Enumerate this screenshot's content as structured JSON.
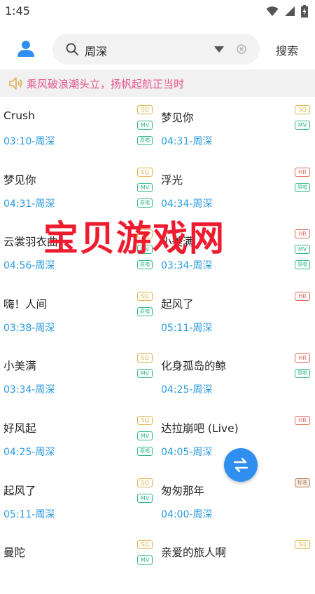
{
  "status_bar": {
    "time": "1:45"
  },
  "header": {
    "search_value": "周深",
    "search_button": "搜索"
  },
  "notice": {
    "text": "乘风破浪潮头立，扬帆起航正当时"
  },
  "songs": [
    {
      "title": "Crush",
      "meta": "03:10-周深",
      "badges": [
        {
          "type": "sq",
          "label": "SQ"
        },
        {
          "type": "mv",
          "label": "MV"
        },
        {
          "type": "src",
          "label": "原唱"
        }
      ]
    },
    {
      "title": "梦见你",
      "meta": "04:31-周深",
      "badges": [
        {
          "type": "sq",
          "label": "SQ"
        },
        {
          "type": "mv",
          "label": "MV"
        }
      ]
    },
    {
      "title": "梦见你",
      "meta": "04:31-周深",
      "badges": [
        {
          "type": "sq",
          "label": "SQ"
        },
        {
          "type": "mv",
          "label": "MV"
        },
        {
          "type": "src",
          "label": "原唱"
        }
      ]
    },
    {
      "title": "浮光",
      "meta": "04:34-周深",
      "badges": [
        {
          "type": "hr",
          "label": "HR"
        },
        {
          "type": "src",
          "label": "原唱"
        }
      ]
    },
    {
      "title": "云裳羽衣曲",
      "meta": "04:56-周深",
      "badges": [
        {
          "type": "sq",
          "label": "SQ"
        },
        {
          "type": "mv",
          "label": "MV"
        },
        {
          "type": "src",
          "label": "原唱"
        }
      ]
    },
    {
      "title": "小美满",
      "meta": "03:34-周深",
      "badges": [
        {
          "type": "hr",
          "label": "HR"
        },
        {
          "type": "mv",
          "label": "MV"
        },
        {
          "type": "src",
          "label": "原唱"
        }
      ]
    },
    {
      "title": "嗨！人间",
      "meta": "03:38-周深",
      "badges": [
        {
          "type": "sq",
          "label": "SQ"
        },
        {
          "type": "src",
          "label": "原唱"
        }
      ]
    },
    {
      "title": "起风了",
      "meta": "05:11-周深",
      "badges": [
        {
          "type": "hr",
          "label": "HR"
        }
      ]
    },
    {
      "title": "小美满",
      "meta": "03:34-周深",
      "badges": [
        {
          "type": "sq",
          "label": "SQ"
        },
        {
          "type": "mv",
          "label": "MV"
        }
      ]
    },
    {
      "title": "化身孤岛的鲸",
      "meta": "04:25-周深",
      "badges": [
        {
          "type": "hr",
          "label": "HR"
        },
        {
          "type": "src",
          "label": "原唱"
        }
      ]
    },
    {
      "title": "好风起",
      "meta": "04:25-周深",
      "badges": [
        {
          "type": "sq",
          "label": "SQ"
        },
        {
          "type": "mv",
          "label": "MV"
        },
        {
          "type": "src",
          "label": "原唱"
        }
      ]
    },
    {
      "title": "达拉崩吧 (Live)",
      "meta": "04:05-周深",
      "badges": [
        {
          "type": "hr",
          "label": "HR"
        }
      ]
    },
    {
      "title": "起风了",
      "meta": "05:11-周深",
      "badges": [
        {
          "type": "sq",
          "label": "SQ"
        },
        {
          "type": "mv",
          "label": "MV"
        }
      ]
    },
    {
      "title": "匆匆那年",
      "meta": "04:00-周深",
      "badges": [
        {
          "type": "std",
          "label": "标准"
        }
      ]
    },
    {
      "title": "曼陀",
      "meta": "",
      "badges": [
        {
          "type": "sq",
          "label": "SQ"
        },
        {
          "type": "mv",
          "label": "MV"
        }
      ]
    },
    {
      "title": "亲爱的旅人啊",
      "meta": "",
      "badges": [
        {
          "type": "sq",
          "label": "SQ"
        }
      ]
    }
  ],
  "watermark": "宝贝游戏网"
}
